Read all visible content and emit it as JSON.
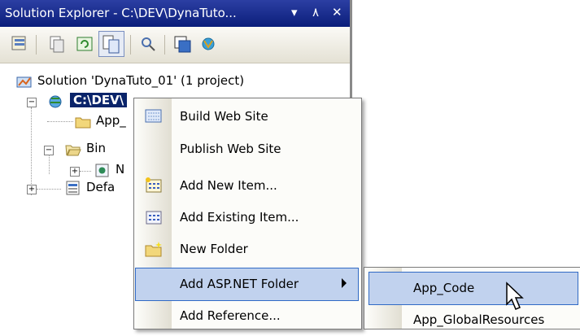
{
  "window": {
    "title": "Solution Explorer - C:\\DEV\\DynaTuto... ▾  ٨ ✕",
    "title_text": "Solution Explorer - C:\\DEV\\DynaTuto...",
    "title_dropdown": "▾",
    "title_pin": "٨",
    "title_close": "✕"
  },
  "toolbar": {
    "buttons": [
      "properties",
      "show-all-files",
      "refresh",
      "nest-related-files",
      "view-code",
      "view-designer",
      "copy-web-site"
    ]
  },
  "tree": {
    "solution": "Solution 'DynaTuto_01' (1 project)",
    "project": "C:\\DEV\\",
    "app_data": "App_",
    "bin": "Bin",
    "bin_child": "N",
    "default": "Defa"
  },
  "context_menu": {
    "items": [
      {
        "label": "Build Web Site",
        "icon": "build-icon"
      },
      {
        "label": "Publish Web Site",
        "icon": ""
      },
      {
        "label": "Add New Item...",
        "icon": "add-new-item-icon"
      },
      {
        "label": "Add Existing Item...",
        "icon": "add-existing-item-icon"
      },
      {
        "label": "New Folder",
        "icon": "new-folder-icon"
      },
      {
        "label": "Add ASP.NET Folder",
        "icon": "",
        "has_submenu": true,
        "highlighted": true
      },
      {
        "label": "Add Reference...",
        "icon": ""
      }
    ]
  },
  "submenu": {
    "items": [
      {
        "label": "App_Code",
        "highlighted": true
      },
      {
        "label": "App_GlobalResources"
      }
    ]
  },
  "colors": {
    "title_bar": "#0a1d7a",
    "selection": "#0a246a",
    "menu_highlight": "#c1d2ee",
    "menu_highlight_border": "#316ac5"
  }
}
